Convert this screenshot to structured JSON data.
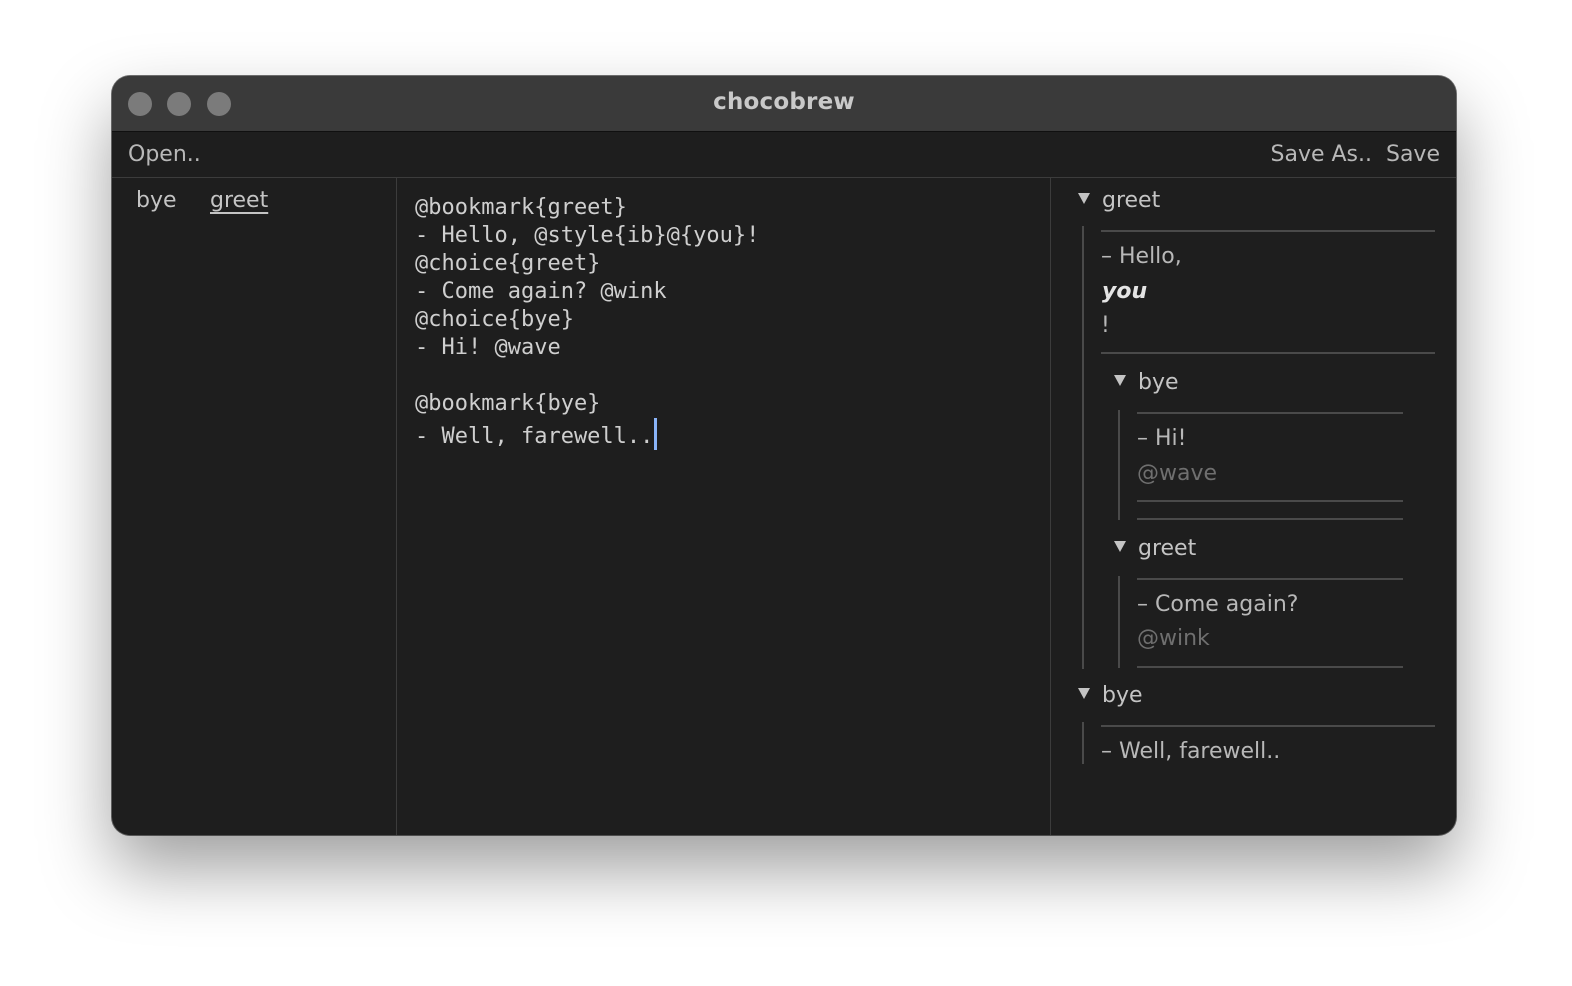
{
  "window": {
    "title": "chocobrew"
  },
  "menu": {
    "open_label": "Open..",
    "save_as_label": "Save As..",
    "save_label": "Save"
  },
  "bookmarks": {
    "tabs": [
      "bye",
      "greet"
    ],
    "active": "greet"
  },
  "editor": {
    "lines": [
      "@bookmark{greet}",
      "- Hello, @style{ib}@{you}!",
      "@choice{greet}",
      "- Come again? @wink",
      "@choice{bye}",
      "- Hi! @wave",
      "",
      "@bookmark{bye}",
      "- Well, farewell.."
    ],
    "caret_color": "#8ab4f8"
  },
  "preview": {
    "greet": {
      "title": "greet",
      "text_prefix": "– Hello,",
      "text_styled": "you",
      "text_suffix": "!",
      "choices": [
        {
          "title": "bye",
          "text": "– Hi!",
          "tag": "@wave"
        },
        {
          "title": "greet",
          "text": "– Come again?",
          "tag": "@wink"
        }
      ]
    },
    "bye": {
      "title": "bye",
      "text": "– Well, farewell.."
    }
  }
}
